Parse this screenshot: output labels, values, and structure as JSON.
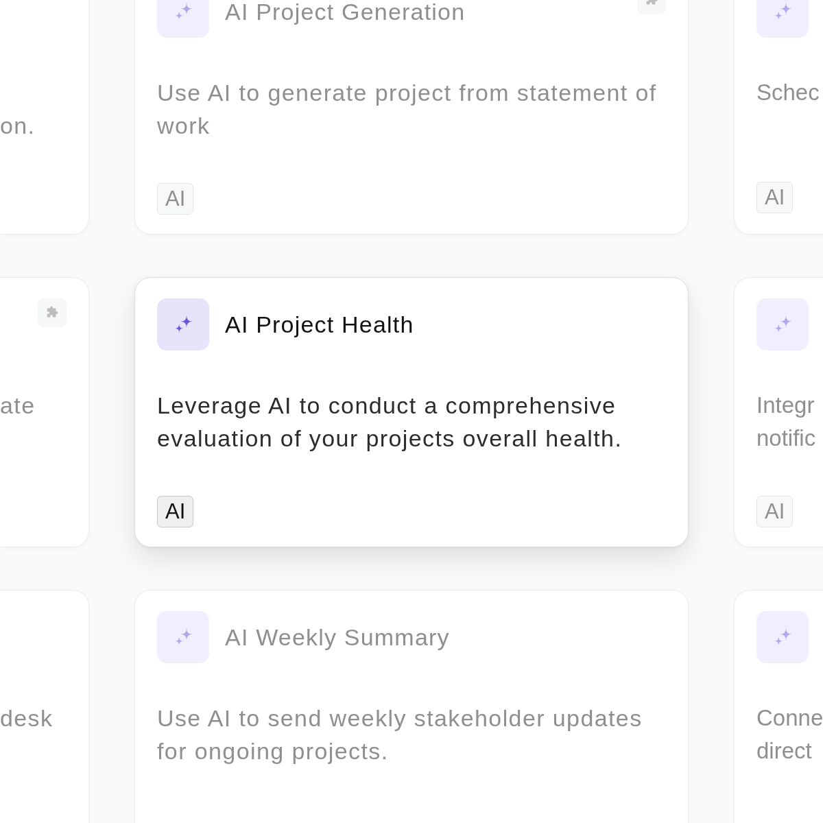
{
  "rows": [
    {
      "cards": [
        {
          "kind": "left",
          "selected": false,
          "description": "on.",
          "plugin": false
        },
        {
          "kind": "center",
          "selected": false,
          "title": "AI Project Generation",
          "description": "Use AI to generate project from statement of work",
          "tag": "AI",
          "plugin": true
        },
        {
          "kind": "right",
          "selected": false,
          "description": "Schec",
          "tag": "AI",
          "plugin": false
        }
      ]
    },
    {
      "cards": [
        {
          "kind": "left",
          "selected": false,
          "description": "ate",
          "plugin": true
        },
        {
          "kind": "center",
          "selected": true,
          "title": "AI Project Health",
          "description": "Leverage AI to conduct a comprehensive evaluation of your projects overall health.",
          "tag": "AI",
          "plugin": false
        },
        {
          "kind": "right",
          "selected": false,
          "description": "Integr notific",
          "tag": "AI",
          "plugin": false
        }
      ]
    },
    {
      "cards": [
        {
          "kind": "left",
          "selected": false,
          "description": "desk",
          "plugin": false
        },
        {
          "kind": "center",
          "selected": false,
          "title": "AI Weekly Summary",
          "description": "Use AI to send weekly stakeholder updates for ongoing projects.",
          "plugin": false
        },
        {
          "kind": "right",
          "selected": false,
          "description": "Conne direct",
          "plugin": false
        }
      ]
    }
  ]
}
